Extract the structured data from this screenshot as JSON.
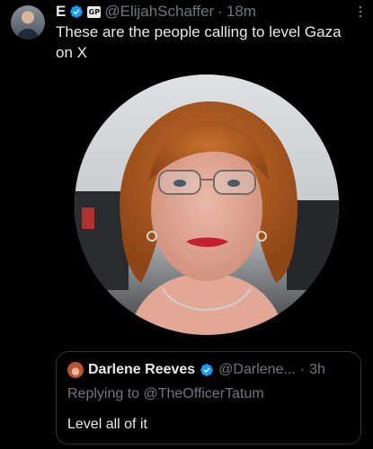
{
  "tweet": {
    "display_name": "E",
    "affiliation_badge": "GP",
    "handle": "@ElijahSchaffer",
    "separator": "·",
    "time": "18m",
    "more_icon": "ellipsis-vertical-icon",
    "text": "These are the people calling to level Gaza on X"
  },
  "quote": {
    "display_name": "Darlene Reeves",
    "handle": "@Darlene...",
    "separator": "·",
    "time": "3h",
    "replying_to": "Replying to @TheOfficerTatum",
    "text": "Level all of it"
  },
  "colors": {
    "background": "#000000",
    "text": "#e7e9ea",
    "muted": "#71767b",
    "verified_blue": "#1d9bf0",
    "border": "#2f3336"
  }
}
